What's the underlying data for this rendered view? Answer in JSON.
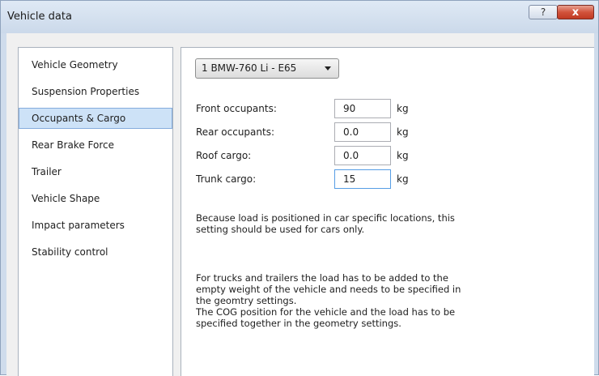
{
  "window": {
    "title": "Vehicle data",
    "help_label": "?",
    "close_label": "x"
  },
  "sidebar": {
    "items": [
      {
        "label": "Vehicle Geometry"
      },
      {
        "label": "Suspension Properties"
      },
      {
        "label": "Occupants & Cargo",
        "selected": true
      },
      {
        "label": "Rear Brake Force"
      },
      {
        "label": "Trailer"
      },
      {
        "label": "Vehicle Shape"
      },
      {
        "label": "Impact parameters"
      },
      {
        "label": "Stability control"
      }
    ]
  },
  "panel": {
    "vehicle_select": {
      "value": "1 BMW-760 Li - E65"
    },
    "rows": [
      {
        "label": "Front occupants:",
        "value": "90",
        "unit": "kg"
      },
      {
        "label": "Rear occupants:",
        "value": "0.0",
        "unit": "kg"
      },
      {
        "label": "Roof cargo:",
        "value": "0.0",
        "unit": "kg"
      },
      {
        "label": "Trunk cargo:",
        "value": "15",
        "unit": "kg"
      }
    ],
    "note1_line1": "Because load is positioned in car specific locations, this",
    "note1_line2": "setting should be used for cars only.",
    "note2_line1": "For trucks and trailers the load has to be added to the",
    "note2_line2": "empty weight of the vehicle and needs to be specified in",
    "note2_line3": "the geomtry settings.",
    "note2_line4": "The COG position for the vehicle and the load has to be",
    "note2_line5": "specified together in the geometry settings."
  },
  "colors": {
    "selection": "#cde2f7",
    "close_button": "#c9452c",
    "focus_border": "#569de5"
  }
}
